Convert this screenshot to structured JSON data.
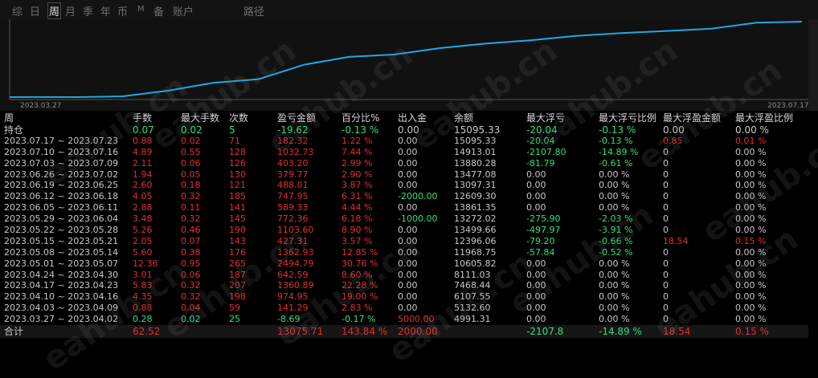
{
  "tabs": [
    "综",
    "日",
    "周",
    "月",
    "季",
    "年",
    "币",
    "M",
    "备",
    "账户",
    "路径"
  ],
  "active_tab": 2,
  "chart": {
    "start_label": "2023.03.27",
    "end_label": "2023.07.17",
    "line_color": "#1fa8e6"
  },
  "columns": [
    "周",
    "手数",
    "最大手数",
    "次数",
    "盈亏金额",
    "百分比%",
    "出入金",
    "余额",
    "最大浮亏",
    "最大浮亏比例",
    "最大浮盈金额",
    "最大浮盈比例"
  ],
  "holding": {
    "label": "持仓",
    "lots": "0.07",
    "max_lots": "0.02",
    "count": "5",
    "pnl": "-19.62",
    "pct": "-0.13 %",
    "io": "0.00",
    "balance": "15095.33",
    "max_dd": "-20.04",
    "max_dd_pct": "-0.13 %",
    "max_fp": "0.00",
    "max_fp_pct": "0.00 %"
  },
  "rows": [
    {
      "period": "2023.07.17 ~ 2023.07.23",
      "lots": "0.88",
      "max_lots": "0.02",
      "count": "71",
      "pnl": "182.32",
      "pct": "1.22 %",
      "io": "0.00",
      "balance": "15095.33",
      "max_dd": "-20.04",
      "max_dd_pct": "-0.13 %",
      "max_fp": "0.85",
      "max_fp_pct": "0.01 %"
    },
    {
      "period": "2023.07.10 ~ 2023.07.16",
      "lots": "4.89",
      "max_lots": "0.55",
      "count": "128",
      "pnl": "1032.73",
      "pct": "7.44 %",
      "io": "0.00",
      "balance": "14913.01",
      "max_dd": "-2107.80",
      "max_dd_pct": "-14.89 %",
      "max_fp": "0",
      "max_fp_pct": "0.00 %"
    },
    {
      "period": "2023.07.03 ~ 2023.07.09",
      "lots": "2.11",
      "max_lots": "0.06",
      "count": "126",
      "pnl": "403.20",
      "pct": "2.99 %",
      "io": "0.00",
      "balance": "13880.28",
      "max_dd": "-81.79",
      "max_dd_pct": "-0.61 %",
      "max_fp": "0",
      "max_fp_pct": "0.00 %"
    },
    {
      "period": "2023.06.26 ~ 2023.07.02",
      "lots": "1.94",
      "max_lots": "0.05",
      "count": "130",
      "pnl": "379.77",
      "pct": "2.90 %",
      "io": "0.00",
      "balance": "13477.08",
      "max_dd": "0.00",
      "max_dd_pct": "0.00 %",
      "max_fp": "0",
      "max_fp_pct": "0.00 %"
    },
    {
      "period": "2023.06.19 ~ 2023.06.25",
      "lots": "2.60",
      "max_lots": "0.18",
      "count": "121",
      "pnl": "488.01",
      "pct": "3.87 %",
      "io": "0.00",
      "balance": "13097.31",
      "max_dd": "0.00",
      "max_dd_pct": "0.00 %",
      "max_fp": "0",
      "max_fp_pct": "0.00 %"
    },
    {
      "period": "2023.06.12 ~ 2023.06.18",
      "lots": "4.05",
      "max_lots": "0.32",
      "count": "185",
      "pnl": "747.95",
      "pct": "6.31 %",
      "io": "-2000.00",
      "balance": "12609.30",
      "max_dd": "0.00",
      "max_dd_pct": "0.00 %",
      "max_fp": "0",
      "max_fp_pct": "0.00 %"
    },
    {
      "period": "2023.06.05 ~ 2023.06.11",
      "lots": "2.88",
      "max_lots": "0.11",
      "count": "141",
      "pnl": "589.33",
      "pct": "4.44 %",
      "io": "0.00",
      "balance": "13861.35",
      "max_dd": "0.00",
      "max_dd_pct": "0.00 %",
      "max_fp": "0",
      "max_fp_pct": "0.00 %"
    },
    {
      "period": "2023.05.29 ~ 2023.06.04",
      "lots": "3.48",
      "max_lots": "0.32",
      "count": "145",
      "pnl": "772.36",
      "pct": "6.18 %",
      "io": "-1000.00",
      "balance": "13272.02",
      "max_dd": "-275.90",
      "max_dd_pct": "-2.03 %",
      "max_fp": "0",
      "max_fp_pct": "0.00 %"
    },
    {
      "period": "2023.05.22 ~ 2023.05.28",
      "lots": "5.26",
      "max_lots": "0.46",
      "count": "190",
      "pnl": "1103.60",
      "pct": "8.90 %",
      "io": "0.00",
      "balance": "13499.66",
      "max_dd": "-497.97",
      "max_dd_pct": "-3.91 %",
      "max_fp": "0",
      "max_fp_pct": "0.00 %"
    },
    {
      "period": "2023.05.15 ~ 2023.05.21",
      "lots": "2.05",
      "max_lots": "0.07",
      "count": "143",
      "pnl": "427.31",
      "pct": "3.57 %",
      "io": "0.00",
      "balance": "12396.06",
      "max_dd": "-79.20",
      "max_dd_pct": "-0.66 %",
      "max_fp": "18.54",
      "max_fp_pct": "0.15 %"
    },
    {
      "period": "2023.05.08 ~ 2023.05.14",
      "lots": "5.60",
      "max_lots": "0.38",
      "count": "176",
      "pnl": "1362.93",
      "pct": "12.85 %",
      "io": "0.00",
      "balance": "11968.75",
      "max_dd": "-57.84",
      "max_dd_pct": "-0.52 %",
      "max_fp": "0",
      "max_fp_pct": "0.00 %"
    },
    {
      "period": "2023.05.01 ~ 2023.05.07",
      "lots": "12.36",
      "max_lots": "0.95",
      "count": "265",
      "pnl": "2494.79",
      "pct": "30.76 %",
      "io": "0.00",
      "balance": "10605.82",
      "max_dd": "0.00",
      "max_dd_pct": "0.00 %",
      "max_fp": "0",
      "max_fp_pct": "0.00 %"
    },
    {
      "period": "2023.04.24 ~ 2023.04.30",
      "lots": "3.01",
      "max_lots": "0.06",
      "count": "187",
      "pnl": "642.59",
      "pct": "8.60 %",
      "io": "0.00",
      "balance": "8111.03",
      "max_dd": "0.00",
      "max_dd_pct": "0.00 %",
      "max_fp": "0",
      "max_fp_pct": "0.00 %"
    },
    {
      "period": "2023.04.17 ~ 2023.04.23",
      "lots": "5.83",
      "max_lots": "0.32",
      "count": "207",
      "pnl": "1360.89",
      "pct": "22.28 %",
      "io": "0.00",
      "balance": "7468.44",
      "max_dd": "0.00",
      "max_dd_pct": "0.00 %",
      "max_fp": "0",
      "max_fp_pct": "0.00 %"
    },
    {
      "period": "2023.04.10 ~ 2023.04.16",
      "lots": "4.35",
      "max_lots": "0.32",
      "count": "198",
      "pnl": "974.95",
      "pct": "19.00 %",
      "io": "0.00",
      "balance": "6107.55",
      "max_dd": "0.00",
      "max_dd_pct": "0.00 %",
      "max_fp": "0",
      "max_fp_pct": "0.00 %"
    },
    {
      "period": "2023.04.03 ~ 2023.04.09",
      "lots": "0.88",
      "max_lots": "0.04",
      "count": "59",
      "pnl": "141.29",
      "pct": "2.83 %",
      "io": "0.00",
      "balance": "5132.60",
      "max_dd": "0.00",
      "max_dd_pct": "0.00 %",
      "max_fp": "0",
      "max_fp_pct": "0.00 %"
    },
    {
      "period": "2023.03.27 ~ 2023.04.02",
      "lots": "0.28",
      "max_lots": "0.02",
      "count": "25",
      "pnl": "-8.69",
      "pct": "-0.17 %",
      "io": "5000.00",
      "balance": "4991.31",
      "max_dd": "0.00",
      "max_dd_pct": "0.00 %",
      "max_fp": "0",
      "max_fp_pct": "0.00 %"
    }
  ],
  "total": {
    "label": "合计",
    "lots": "62.52",
    "pnl": "13075.71",
    "pct": "143.84 %",
    "io": "2000.00",
    "max_dd": "-2107.8",
    "max_dd_pct": "-14.89 %",
    "max_fp": "18.54",
    "max_fp_pct": "0.15 %"
  },
  "watermark": "eahub.cn"
}
